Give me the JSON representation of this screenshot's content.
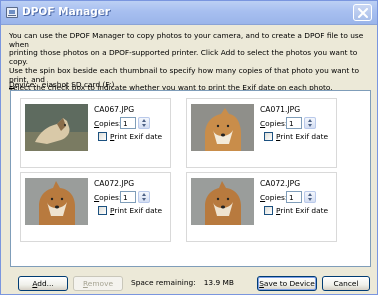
{
  "window": {
    "title": "DPOF Manager"
  },
  "intro": {
    "line1": "You can use the DPOF Manager to copy photos to your camera, and to create a DPOF file to use when",
    "line2": "printing those photos on a DPOF-supported printer. Click Add to select the photos you want to copy.",
    "line3": "Use the spin box beside each thumbnail to specify how many copies of that photo you want to print, and",
    "line4": "select the check box to indicate whether you want to print the Exif date on each photo."
  },
  "device": {
    "label_first": "D",
    "label_rest": "evice:",
    "value": "eiashot SD card (F:)"
  },
  "photos": [
    {
      "filename": "CA067.JPG",
      "copies": "1",
      "copies_label_first": "C",
      "copies_label_rest": "opies:",
      "print_label_first": "P",
      "print_label_rest": "rint Exif date",
      "print_exif": false
    },
    {
      "filename": "CA071.JPG",
      "copies": "1",
      "copies_label_first": "C",
      "copies_label_rest": "opies:",
      "print_label_first": "P",
      "print_label_rest": "rint Exif date",
      "print_exif": false
    },
    {
      "filename": "CA072.JPG",
      "copies": "1",
      "copies_label_first": "C",
      "copies_label_rest": "opies:",
      "print_label_first": "P",
      "print_label_rest": "rint Exif date",
      "print_exif": false
    },
    {
      "filename": "CA072.JPG",
      "copies": "1",
      "copies_label_first": "C",
      "copies_label_rest": "opies:",
      "print_label_first": "P",
      "print_label_rest": "rint Exif date",
      "print_exif": false
    }
  ],
  "footer": {
    "add_first": "A",
    "add_rest": "dd...",
    "remove_first": "R",
    "remove_rest": "emove",
    "space_label": "Space remaining:",
    "space_value": "13.9 MB",
    "save_first": "S",
    "save_rest": "ave to Device",
    "cancel_label": "Cancel"
  }
}
